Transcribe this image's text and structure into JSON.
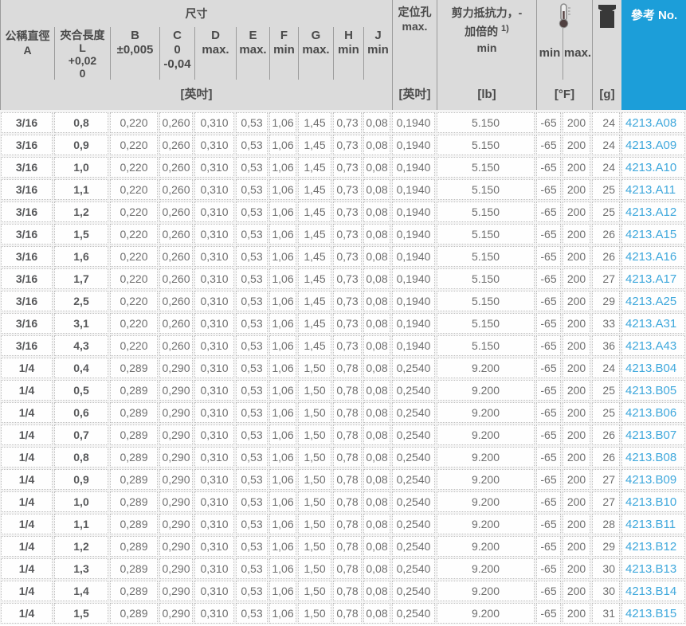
{
  "header": {
    "size_group_label": "尺寸",
    "col_nominal_diameter": {
      "l1": "公稱直徑",
      "l2": "A"
    },
    "col_grip_length": {
      "l1": "夾合長度",
      "l2": "L",
      "l3": "+0,02",
      "l4": "0"
    },
    "col_b": {
      "l1": "B",
      "l2": "±0,005"
    },
    "col_c": {
      "l1": "C",
      "l2": "0",
      "l3": "-0,04"
    },
    "col_d": {
      "l1": "D",
      "l2": "max."
    },
    "col_e": {
      "l1": "E",
      "l2": "max."
    },
    "col_f": {
      "l1": "F",
      "l2": "min"
    },
    "col_g": {
      "l1": "G",
      "l2": "max."
    },
    "col_h": {
      "l1": "H",
      "l2": "min"
    },
    "col_j": {
      "l1": "J",
      "l2": "min"
    },
    "col_pilot_hole": {
      "l1": "定位孔",
      "l2": "max."
    },
    "col_shear": {
      "l1": "剪力抵抗力，-",
      "l2": "加倍的",
      "sup": "1)",
      "l3": "min"
    },
    "col_temp_min": "min",
    "col_temp_max": "max.",
    "col_ref": "參考 No.",
    "units": {
      "dims": "[英吋]",
      "pilot_hole": "[英吋]",
      "shear": "[lb]",
      "temp": "[°F]",
      "weight": "[g]"
    },
    "icons": {
      "thermometer": "thermometer-icon",
      "weight": "weight-icon"
    }
  },
  "colors": {
    "accent_blue": "#1C9ED9",
    "link_blue": "#3FA8DC",
    "header_bg": "#DBDBDB",
    "header_text": "#4A4A4A",
    "data_text": "#6F6F6F",
    "bold_col_text": "#58595B",
    "divider": "#9B9B9B",
    "dotted_border": "#BDBDBD"
  },
  "table": {
    "rows": [
      [
        "3/16",
        "0,8",
        "0,220",
        "0,260",
        "0,310",
        "0,53",
        "1,06",
        "1,45",
        "0,73",
        "0,08",
        "0,1940",
        "5.150",
        "-65",
        "200",
        "24",
        "4213.A08"
      ],
      [
        "3/16",
        "0,9",
        "0,220",
        "0,260",
        "0,310",
        "0,53",
        "1,06",
        "1,45",
        "0,73",
        "0,08",
        "0,1940",
        "5.150",
        "-65",
        "200",
        "24",
        "4213.A09"
      ],
      [
        "3/16",
        "1,0",
        "0,220",
        "0,260",
        "0,310",
        "0,53",
        "1,06",
        "1,45",
        "0,73",
        "0,08",
        "0,1940",
        "5.150",
        "-65",
        "200",
        "24",
        "4213.A10"
      ],
      [
        "3/16",
        "1,1",
        "0,220",
        "0,260",
        "0,310",
        "0,53",
        "1,06",
        "1,45",
        "0,73",
        "0,08",
        "0,1940",
        "5.150",
        "-65",
        "200",
        "25",
        "4213.A11"
      ],
      [
        "3/16",
        "1,2",
        "0,220",
        "0,260",
        "0,310",
        "0,53",
        "1,06",
        "1,45",
        "0,73",
        "0,08",
        "0,1940",
        "5.150",
        "-65",
        "200",
        "25",
        "4213.A12"
      ],
      [
        "3/16",
        "1,5",
        "0,220",
        "0,260",
        "0,310",
        "0,53",
        "1,06",
        "1,45",
        "0,73",
        "0,08",
        "0,1940",
        "5.150",
        "-65",
        "200",
        "26",
        "4213.A15"
      ],
      [
        "3/16",
        "1,6",
        "0,220",
        "0,260",
        "0,310",
        "0,53",
        "1,06",
        "1,45",
        "0,73",
        "0,08",
        "0,1940",
        "5.150",
        "-65",
        "200",
        "26",
        "4213.A16"
      ],
      [
        "3/16",
        "1,7",
        "0,220",
        "0,260",
        "0,310",
        "0,53",
        "1,06",
        "1,45",
        "0,73",
        "0,08",
        "0,1940",
        "5.150",
        "-65",
        "200",
        "27",
        "4213.A17"
      ],
      [
        "3/16",
        "2,5",
        "0,220",
        "0,260",
        "0,310",
        "0,53",
        "1,06",
        "1,45",
        "0,73",
        "0,08",
        "0,1940",
        "5.150",
        "-65",
        "200",
        "29",
        "4213.A25"
      ],
      [
        "3/16",
        "3,1",
        "0,220",
        "0,260",
        "0,310",
        "0,53",
        "1,06",
        "1,45",
        "0,73",
        "0,08",
        "0,1940",
        "5.150",
        "-65",
        "200",
        "33",
        "4213.A31"
      ],
      [
        "3/16",
        "4,3",
        "0,220",
        "0,260",
        "0,310",
        "0,53",
        "1,06",
        "1,45",
        "0,73",
        "0,08",
        "0,1940",
        "5.150",
        "-65",
        "200",
        "36",
        "4213.A43"
      ],
      [
        "1/4",
        "0,4",
        "0,289",
        "0,290",
        "0,310",
        "0,53",
        "1,06",
        "1,50",
        "0,78",
        "0,08",
        "0,2540",
        "9.200",
        "-65",
        "200",
        "24",
        "4213.B04"
      ],
      [
        "1/4",
        "0,5",
        "0,289",
        "0,290",
        "0,310",
        "0,53",
        "1,06",
        "1,50",
        "0,78",
        "0,08",
        "0,2540",
        "9.200",
        "-65",
        "200",
        "25",
        "4213.B05"
      ],
      [
        "1/4",
        "0,6",
        "0,289",
        "0,290",
        "0,310",
        "0,53",
        "1,06",
        "1,50",
        "0,78",
        "0,08",
        "0,2540",
        "9.200",
        "-65",
        "200",
        "25",
        "4213.B06"
      ],
      [
        "1/4",
        "0,7",
        "0,289",
        "0,290",
        "0,310",
        "0,53",
        "1,06",
        "1,50",
        "0,78",
        "0,08",
        "0,2540",
        "9.200",
        "-65",
        "200",
        "26",
        "4213.B07"
      ],
      [
        "1/4",
        "0,8",
        "0,289",
        "0,290",
        "0,310",
        "0,53",
        "1,06",
        "1,50",
        "0,78",
        "0,08",
        "0,2540",
        "9.200",
        "-65",
        "200",
        "26",
        "4213.B08"
      ],
      [
        "1/4",
        "0,9",
        "0,289",
        "0,290",
        "0,310",
        "0,53",
        "1,06",
        "1,50",
        "0,78",
        "0,08",
        "0,2540",
        "9.200",
        "-65",
        "200",
        "27",
        "4213.B09"
      ],
      [
        "1/4",
        "1,0",
        "0,289",
        "0,290",
        "0,310",
        "0,53",
        "1,06",
        "1,50",
        "0,78",
        "0,08",
        "0,2540",
        "9.200",
        "-65",
        "200",
        "27",
        "4213.B10"
      ],
      [
        "1/4",
        "1,1",
        "0,289",
        "0,290",
        "0,310",
        "0,53",
        "1,06",
        "1,50",
        "0,78",
        "0,08",
        "0,2540",
        "9.200",
        "-65",
        "200",
        "28",
        "4213.B11"
      ],
      [
        "1/4",
        "1,2",
        "0,289",
        "0,290",
        "0,310",
        "0,53",
        "1,06",
        "1,50",
        "0,78",
        "0,08",
        "0,2540",
        "9.200",
        "-65",
        "200",
        "29",
        "4213.B12"
      ],
      [
        "1/4",
        "1,3",
        "0,289",
        "0,290",
        "0,310",
        "0,53",
        "1,06",
        "1,50",
        "0,78",
        "0,08",
        "0,2540",
        "9.200",
        "-65",
        "200",
        "30",
        "4213.B13"
      ],
      [
        "1/4",
        "1,4",
        "0,289",
        "0,290",
        "0,310",
        "0,53",
        "1,06",
        "1,50",
        "0,78",
        "0,08",
        "0,2540",
        "9.200",
        "-65",
        "200",
        "30",
        "4213.B14"
      ],
      [
        "1/4",
        "1,5",
        "0,289",
        "0,290",
        "0,310",
        "0,53",
        "1,06",
        "1,50",
        "0,78",
        "0,08",
        "0,2540",
        "9.200",
        "-65",
        "200",
        "31",
        "4213.B15"
      ]
    ]
  }
}
